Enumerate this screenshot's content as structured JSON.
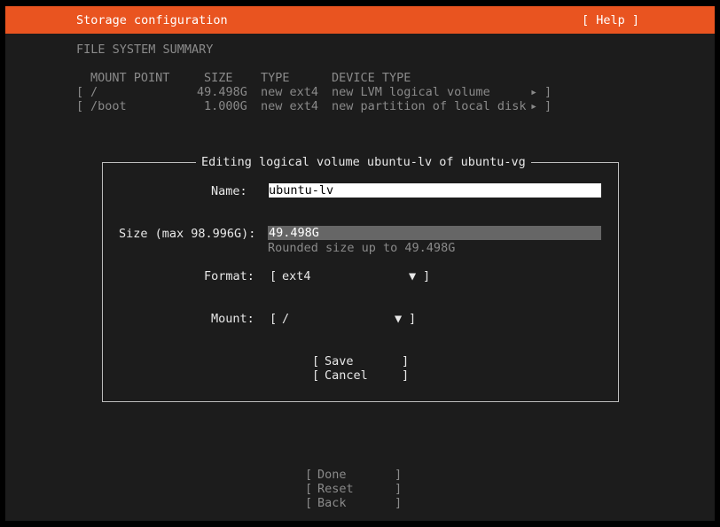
{
  "header": {
    "title": "Storage configuration",
    "help": "[ Help ]"
  },
  "summary": {
    "heading": "FILE SYSTEM SUMMARY",
    "columns": [
      "MOUNT POINT",
      "SIZE",
      "TYPE",
      "DEVICE TYPE"
    ],
    "rows": [
      {
        "open": "[",
        "mount": "/",
        "size": "49.498G",
        "type": "new ext4",
        "device": "new LVM logical volume",
        "arrow": "▸",
        "close": "]"
      },
      {
        "open": "[",
        "mount": "/boot",
        "size": "1.000G",
        "type": "new ext4",
        "device": "new partition of local disk",
        "arrow": "▸",
        "close": "]"
      }
    ]
  },
  "dialog": {
    "title": "Editing logical volume ubuntu-lv of ubuntu-vg",
    "name_label": "Name:",
    "name_value": "ubuntu-lv",
    "size_label": "Size (max 98.996G):",
    "size_value": "49.498G",
    "size_hint": "Rounded size up to 49.498G",
    "format_label": "Format:",
    "format_open": "[",
    "format_value": "ext4",
    "format_arrow": "▼",
    "format_close": "]",
    "mount_label": "Mount:",
    "mount_open": "[",
    "mount_value": "/",
    "mount_arrow": "▼",
    "mount_close": "]",
    "save_open": "[",
    "save_label": "Save",
    "save_close": "]",
    "cancel_open": "[",
    "cancel_label": "Cancel",
    "cancel_close": "]"
  },
  "actions": {
    "done": {
      "open": "[",
      "label": "Done",
      "close": "]"
    },
    "reset": {
      "open": "[",
      "label": "Reset",
      "close": "]"
    },
    "back": {
      "open": "[",
      "label": "Back",
      "close": "]"
    }
  },
  "colors": {
    "header_bg": "#e95420",
    "screen_bg": "#1c1c1c",
    "dim_text": "#8a8a8a",
    "field_active_bg": "#ffffff",
    "field_inactive_bg": "#666666"
  }
}
